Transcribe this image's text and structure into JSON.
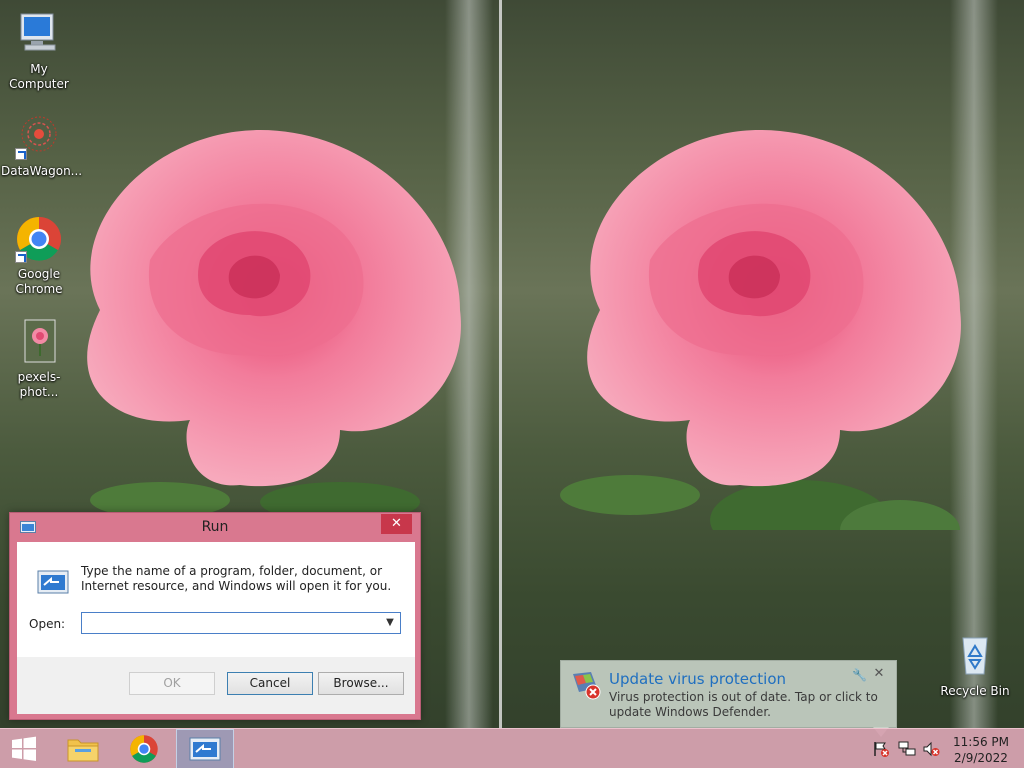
{
  "desktop": {
    "icons": [
      {
        "label": "My Computer"
      },
      {
        "label": "DataWagon..."
      },
      {
        "label": "Google Chrome"
      },
      {
        "label": "pexels-phot..."
      },
      {
        "label": "Recycle Bin"
      }
    ]
  },
  "run_dialog": {
    "title": "Run",
    "close_glyph": "✕",
    "description": "Type the name of a program, folder, document, or Internet resource, and Windows will open it for you.",
    "open_label": "Open:",
    "open_value": "",
    "ok_label": "OK",
    "cancel_label": "Cancel",
    "browse_label": "Browse..."
  },
  "notification": {
    "title": "Update virus protection",
    "message": "Virus protection is out of date. Tap or click to update Windows Defender."
  },
  "taskbar": {
    "pinned": [
      {
        "name": "file-explorer",
        "icon": "folder-icon"
      },
      {
        "name": "google-chrome",
        "icon": "chrome-icon"
      },
      {
        "name": "run",
        "icon": "run-icon",
        "active": true
      }
    ],
    "tray": [
      "action-center-flag-icon",
      "network-icon",
      "volume-muted-icon"
    ],
    "time": "11:56 PM",
    "date": "2/9/2022"
  },
  "colors": {
    "taskbar": "#d6a2b0",
    "window_frame": "#d9788f",
    "close_button": "#c8374b",
    "toast_title": "#1f6fc0"
  }
}
